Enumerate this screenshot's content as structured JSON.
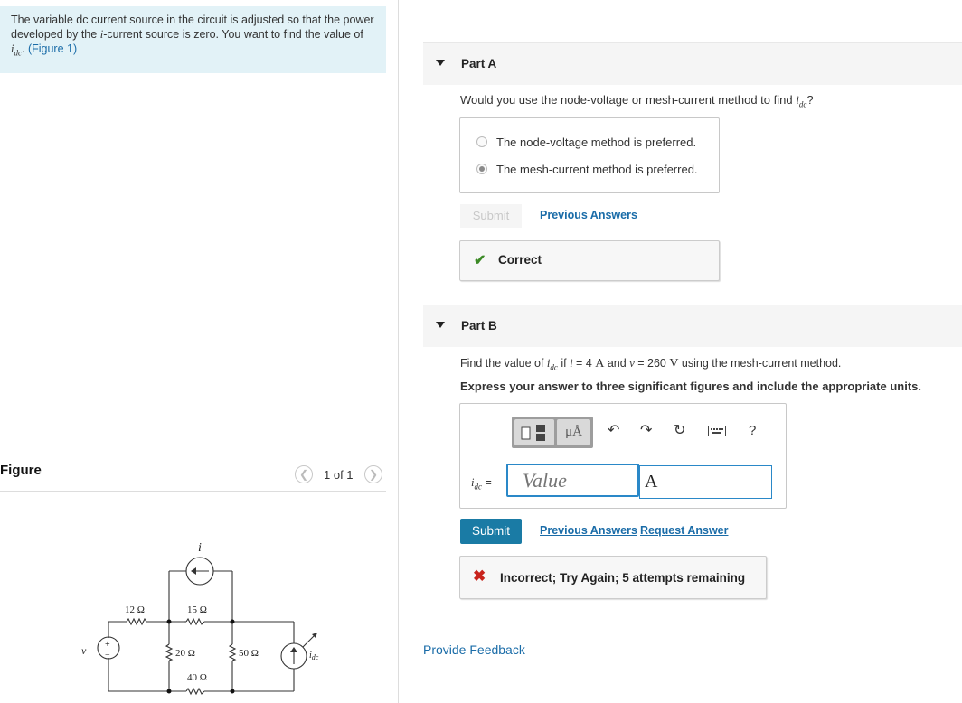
{
  "problem": {
    "intro_pre": "The variable dc current source in the circuit is adjusted so that the power developed by the ",
    "intro_i": "i",
    "intro_mid": "-current source is zero. You want to find the value of ",
    "intro_var": "i",
    "intro_var_sub": "dc",
    "intro_end": ". ",
    "figure_link": "(Figure 1)"
  },
  "figure": {
    "label": "Figure",
    "pagination": "1 of 1",
    "prev_icon": "chevron-left-icon",
    "next_icon": "chevron-right-icon",
    "circuit": {
      "r1": "12 Ω",
      "r2": "15 Ω",
      "r3": "20 Ω",
      "r4": "50 Ω",
      "r5": "40 Ω",
      "current_label": "i",
      "voltage_label": "v",
      "source_label": "i",
      "source_label_sub": "dc",
      "plus": "+",
      "minus": "−"
    }
  },
  "part_a": {
    "title": "Part A",
    "question_pre": "Would you use the node-voltage or mesh-current method to find ",
    "question_var": "i",
    "question_sub": "dc",
    "question_end": "?",
    "options": [
      {
        "label": "The node-voltage method is preferred.",
        "selected": false
      },
      {
        "label": "The mesh-current method is preferred.",
        "selected": true
      }
    ],
    "submit_label": "Submit",
    "previous_answers": "Previous Answers",
    "result_text": "Correct"
  },
  "part_b": {
    "title": "Part B",
    "question_pre": "Find the value of ",
    "q_var": "i",
    "q_sub": "dc",
    "q_if": " if ",
    "q_i": "i",
    "q_eq1": " = 4 ",
    "q_unit1": "A",
    "q_and": " and ",
    "q_v": "v",
    "q_eq2": " = 260 ",
    "q_unit2": "V",
    "q_end": " using the mesh-current method.",
    "instruction": "Express your answer to three significant figures and include the appropriate units.",
    "toolbar": {
      "units_glyph": "μÅ",
      "help": "?"
    },
    "answer_var": "i",
    "answer_sub": "dc",
    "answer_eq": " =",
    "value_placeholder": "Value",
    "unit_value": "A",
    "submit_label": "Submit",
    "previous_answers": "Previous Answers",
    "request_answer": "Request Answer",
    "result_text": "Incorrect; Try Again; 5 attempts remaining"
  },
  "feedback_link": "Provide Feedback",
  "colors": {
    "accent": "#1a7ba5",
    "link": "#1a6ca8",
    "correct": "#3c8a26",
    "incorrect": "#c8231c",
    "intro_bg": "#e2f2f7"
  }
}
